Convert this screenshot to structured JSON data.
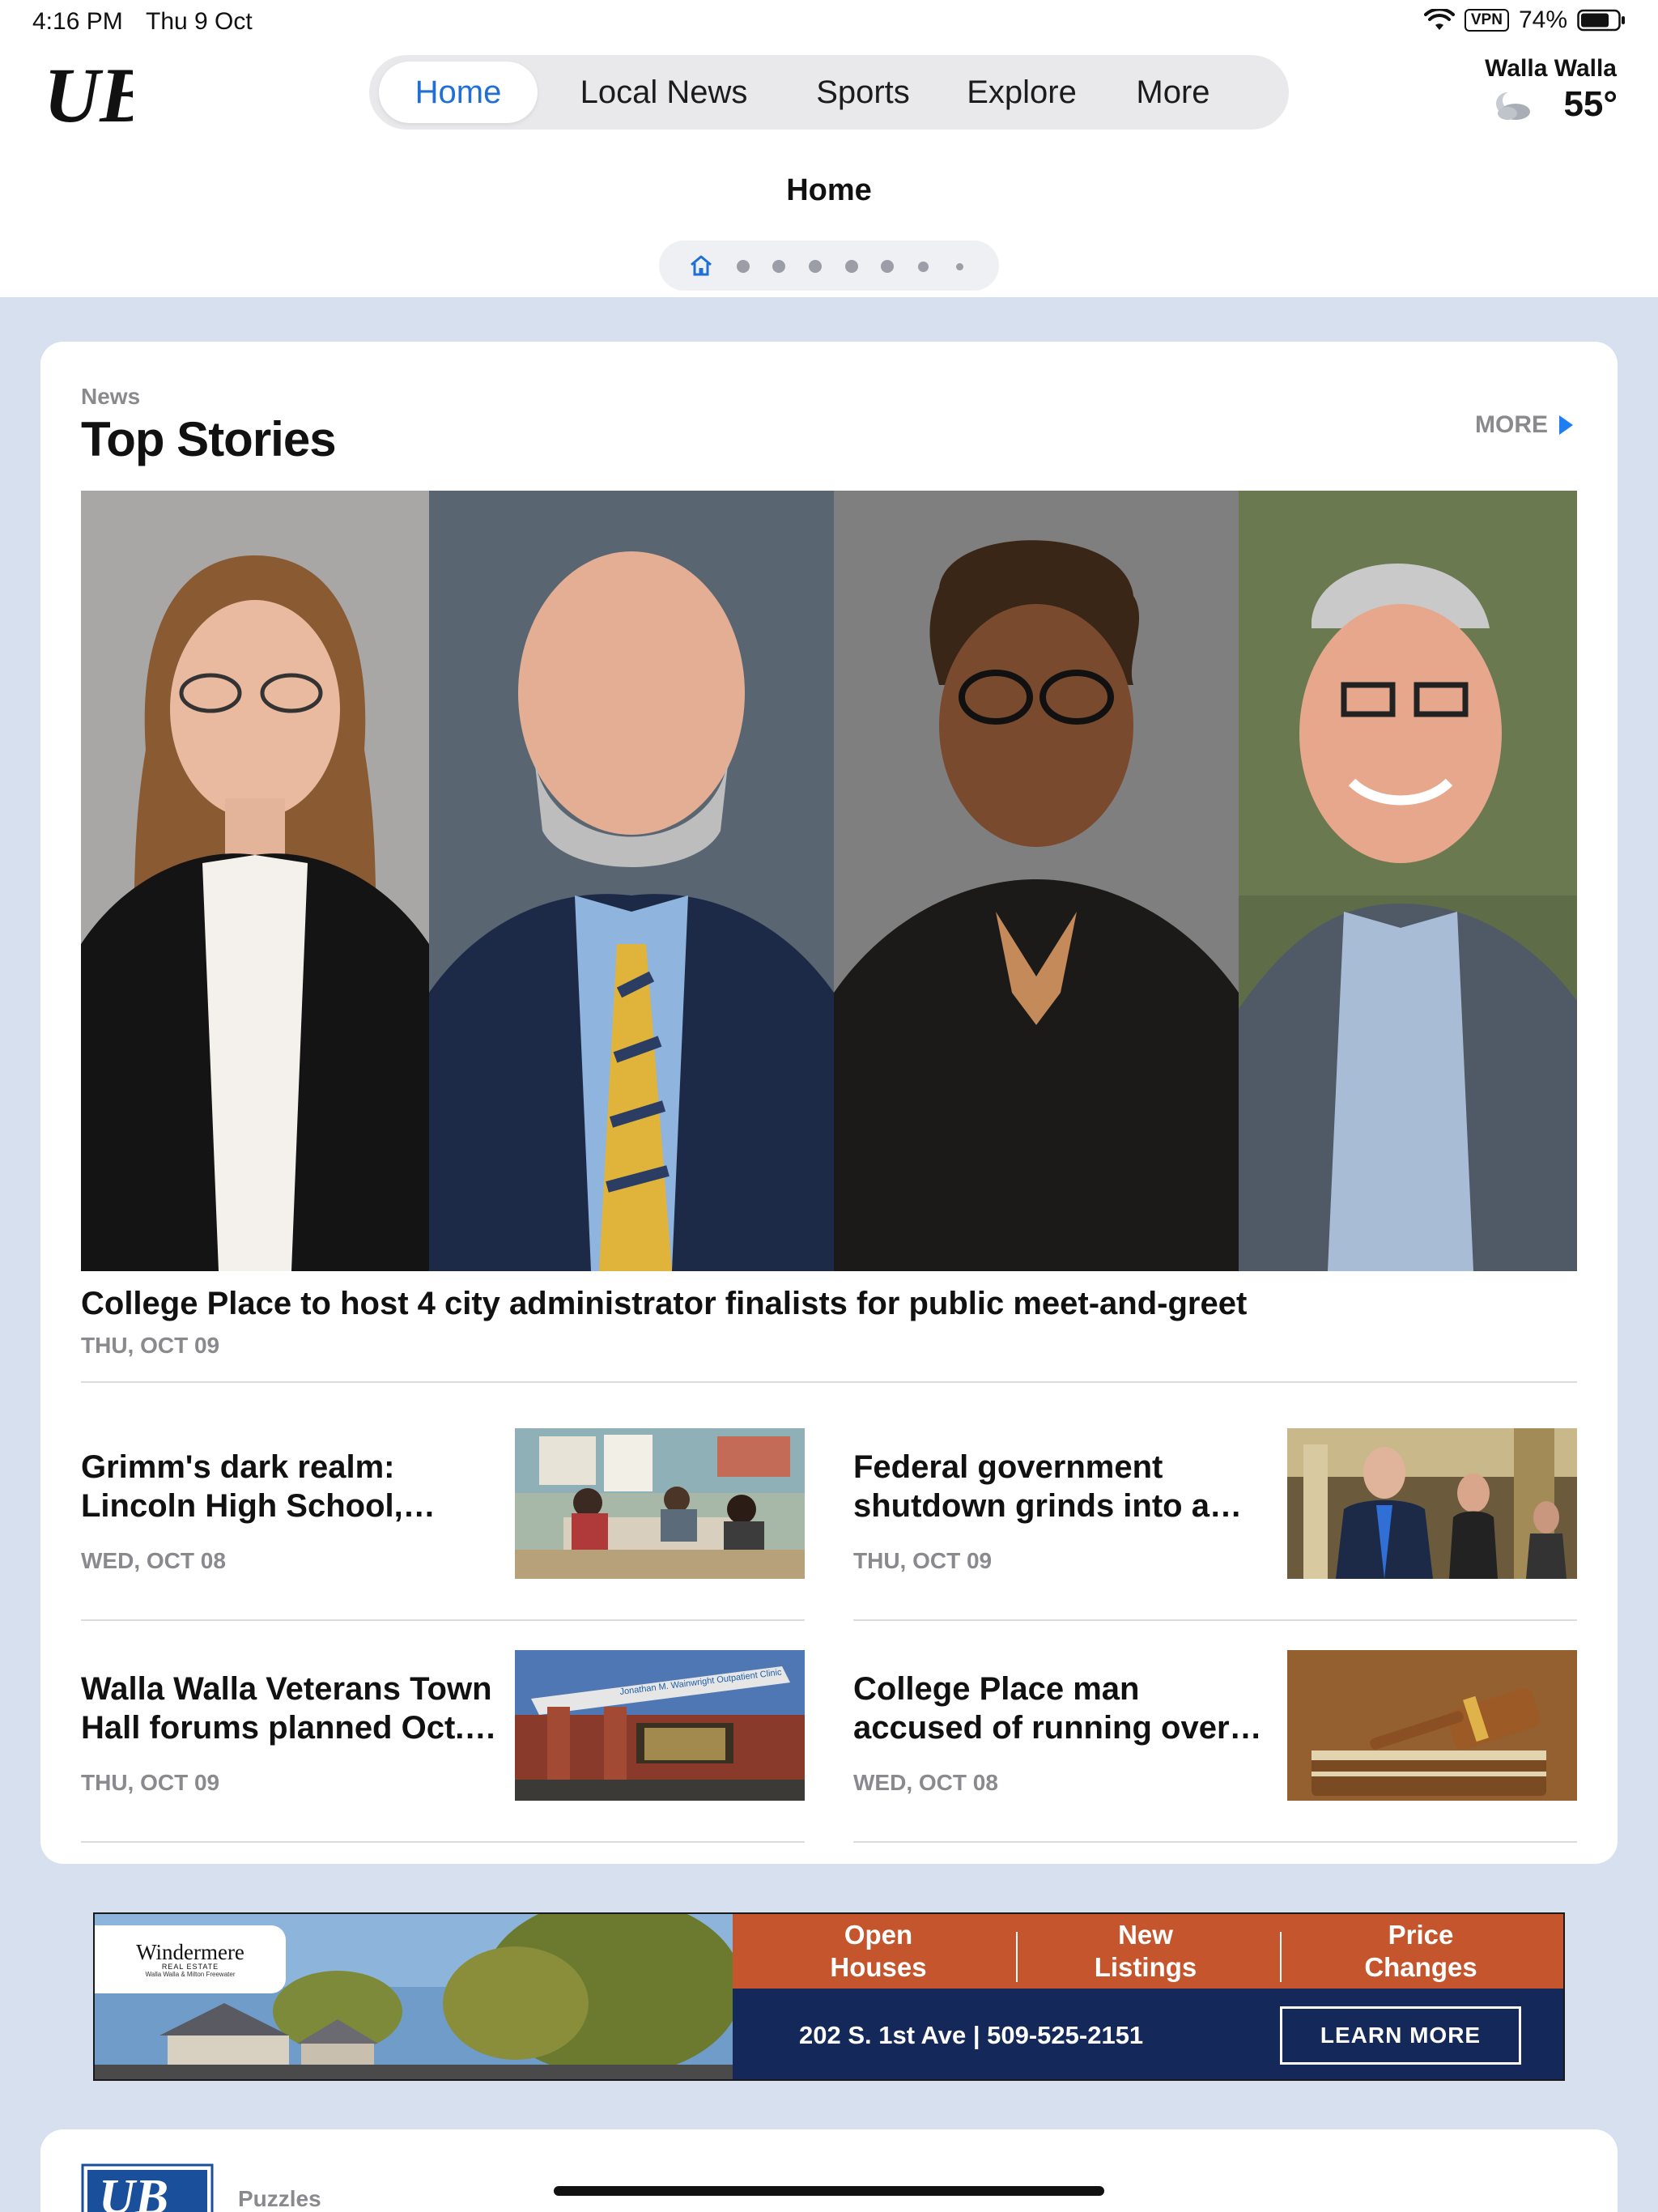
{
  "status_bar": {
    "time": "4:16 PM",
    "date": "Thu 9 Oct",
    "vpn": "VPN",
    "battery": "74%"
  },
  "brand": {
    "logo_text": "UB"
  },
  "nav": {
    "tabs": [
      {
        "label": "Home",
        "active": true
      },
      {
        "label": "Local News",
        "active": false
      },
      {
        "label": "Sports",
        "active": false
      },
      {
        "label": "Explore",
        "active": false
      },
      {
        "label": "More",
        "active": false
      }
    ]
  },
  "weather": {
    "city": "Walla Walla",
    "temperature": "55°",
    "icon": "partly-cloudy-night-icon"
  },
  "page": {
    "heading": "Home",
    "pager_count": 8,
    "pager_active_index": 0
  },
  "top_stories": {
    "kicker": "News",
    "title": "Top Stories",
    "more_label": "MORE",
    "hero": {
      "title": "College Place to host 4 city administrator finalists for public meet-and-greet",
      "date": "THU, OCT 09"
    },
    "stories": [
      {
        "title": "Grimm's dark realm: Lincoln High School, Whitman Col…",
        "date": "WED, OCT 08"
      },
      {
        "title": "Federal government shutdown grinds into a w…",
        "date": "THU, OCT 09"
      },
      {
        "title": "Walla Walla Veterans Town Hall forums planned Oct.…",
        "date": "THU, OCT 09"
      },
      {
        "title": "College Place man accused of running over motorcycl…",
        "date": "WED, OCT 08"
      }
    ]
  },
  "ad": {
    "brand": "Windermere",
    "brand_sub": "REAL ESTATE",
    "brand_tag": "Walla Walla & Milton Freewater",
    "columns": [
      "Open\nHouses",
      "New\nListings",
      "Price\nChanges"
    ],
    "address": "202 S. 1st Ave | 509-525-2151",
    "cta": "LEARN MORE",
    "colors": {
      "orange": "#c5552d",
      "navy": "#14295a"
    }
  },
  "puzzles": {
    "kicker": "Puzzles"
  },
  "colors": {
    "accent": "#1f6fd6",
    "page_bg": "#d6e0ee"
  }
}
